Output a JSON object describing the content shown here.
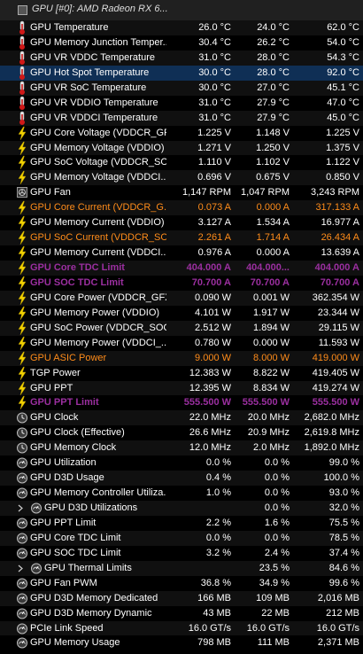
{
  "header": {
    "title": "GPU [#0]: AMD Radeon RX 6..."
  },
  "rows": [
    {
      "icon": "thermometer",
      "label": "GPU Temperature",
      "v": [
        "26.0 °C",
        "24.0 °C",
        "62.0 °C"
      ]
    },
    {
      "icon": "thermometer",
      "label": "GPU Memory Junction Temper...",
      "v": [
        "30.4 °C",
        "26.2 °C",
        "54.0 °C"
      ]
    },
    {
      "icon": "thermometer",
      "label": "GPU VR VDDC Temperature",
      "v": [
        "31.0 °C",
        "28.0 °C",
        "54.3 °C"
      ]
    },
    {
      "icon": "thermometer",
      "label": "GPU Hot Spot Temperature",
      "v": [
        "30.0 °C",
        "28.0 °C",
        "92.0 °C"
      ],
      "selected": true
    },
    {
      "icon": "thermometer",
      "label": "GPU VR SoC Temperature",
      "v": [
        "30.0 °C",
        "27.0 °C",
        "45.1 °C"
      ]
    },
    {
      "icon": "thermometer",
      "label": "GPU VR VDDIO Temperature",
      "v": [
        "31.0 °C",
        "27.9 °C",
        "47.0 °C"
      ]
    },
    {
      "icon": "thermometer",
      "label": "GPU VR VDDCI Temperature",
      "v": [
        "31.0 °C",
        "27.9 °C",
        "45.0 °C"
      ]
    },
    {
      "icon": "bolt",
      "label": "GPU Core Voltage (VDDCR_GFX)",
      "v": [
        "1.225 V",
        "1.148 V",
        "1.225 V"
      ]
    },
    {
      "icon": "bolt",
      "label": "GPU Memory Voltage (VDDIO)",
      "v": [
        "1.271 V",
        "1.250 V",
        "1.375 V"
      ]
    },
    {
      "icon": "bolt",
      "label": "GPU SoC Voltage (VDDCR_SOC)",
      "v": [
        "1.110 V",
        "1.102 V",
        "1.122 V"
      ]
    },
    {
      "icon": "bolt",
      "label": "GPU Memory Voltage (VDDCI...",
      "v": [
        "0.696 V",
        "0.675 V",
        "0.850 V"
      ]
    },
    {
      "icon": "fan",
      "label": "GPU Fan",
      "v": [
        "1,147 RPM",
        "1,047 RPM",
        "3,243 RPM"
      ]
    },
    {
      "icon": "bolt",
      "label": "GPU Core Current (VDDCR_G...",
      "v": [
        "0.073 A",
        "0.000 A",
        "317.133 A"
      ],
      "style": "warn"
    },
    {
      "icon": "bolt",
      "label": "GPU Memory Current (VDDIO)",
      "v": [
        "3.127 A",
        "1.534 A",
        "16.977 A"
      ]
    },
    {
      "icon": "bolt",
      "label": "GPU SoC Current (VDDCR_SOC)",
      "v": [
        "2.261 A",
        "1.714 A",
        "26.434 A"
      ],
      "style": "warn"
    },
    {
      "icon": "bolt",
      "label": "GPU Memory Current (VDDCI...",
      "v": [
        "0.976 A",
        "0.000 A",
        "13.639 A"
      ]
    },
    {
      "icon": "bolt",
      "label": "GPU Core TDC Limit",
      "v": [
        "404.000 A",
        "404.000...",
        "404.000 A"
      ],
      "style": "crit"
    },
    {
      "icon": "bolt",
      "label": "GPU SOC TDC Limit",
      "v": [
        "70.700 A",
        "70.700 A",
        "70.700 A"
      ],
      "style": "crit"
    },
    {
      "icon": "bolt",
      "label": "GPU Core Power (VDDCR_GFX)",
      "v": [
        "0.090 W",
        "0.001 W",
        "362.354 W"
      ]
    },
    {
      "icon": "bolt",
      "label": "GPU Memory Power (VDDIO)",
      "v": [
        "4.101 W",
        "1.917 W",
        "23.344 W"
      ]
    },
    {
      "icon": "bolt",
      "label": "GPU SoC Power (VDDCR_SOC)",
      "v": [
        "2.512 W",
        "1.894 W",
        "29.115 W"
      ]
    },
    {
      "icon": "bolt",
      "label": "GPU Memory Power (VDDCI_...",
      "v": [
        "0.780 W",
        "0.000 W",
        "11.593 W"
      ]
    },
    {
      "icon": "bolt",
      "label": "GPU ASIC Power",
      "v": [
        "9.000 W",
        "8.000 W",
        "419.000 W"
      ],
      "style": "warn"
    },
    {
      "icon": "bolt",
      "label": "TGP Power",
      "v": [
        "12.383 W",
        "8.822 W",
        "419.405 W"
      ]
    },
    {
      "icon": "bolt",
      "label": "GPU PPT",
      "v": [
        "12.395 W",
        "8.834 W",
        "419.274 W"
      ]
    },
    {
      "icon": "bolt",
      "label": "GPU PPT Limit",
      "v": [
        "555.500 W",
        "555.500 W",
        "555.500 W"
      ],
      "style": "crit"
    },
    {
      "icon": "clock",
      "label": "GPU Clock",
      "v": [
        "22.0 MHz",
        "20.0 MHz",
        "2,682.0 MHz"
      ]
    },
    {
      "icon": "clock",
      "label": "GPU Clock (Effective)",
      "v": [
        "26.6 MHz",
        "20.9 MHz",
        "2,619.8 MHz"
      ]
    },
    {
      "icon": "clock",
      "label": "GPU Memory Clock",
      "v": [
        "12.0 MHz",
        "2.0 MHz",
        "1,892.0 MHz"
      ]
    },
    {
      "icon": "gauge",
      "label": "GPU Utilization",
      "v": [
        "0.0 %",
        "0.0 %",
        "99.0 %"
      ]
    },
    {
      "icon": "gauge",
      "label": "GPU D3D Usage",
      "v": [
        "0.4 %",
        "0.0 %",
        "100.0 %"
      ]
    },
    {
      "icon": "gauge",
      "label": "GPU Memory Controller Utiliza...",
      "v": [
        "1.0 %",
        "0.0 %",
        "93.0 %"
      ]
    },
    {
      "icon": "gauge",
      "label": "GPU D3D Utilizations",
      "v": [
        "",
        "0.0 %",
        "32.0 %"
      ],
      "expander": true
    },
    {
      "icon": "gauge",
      "label": "GPU PPT Limit",
      "v": [
        "2.2 %",
        "1.6 %",
        "75.5 %"
      ]
    },
    {
      "icon": "gauge",
      "label": "GPU Core TDC Limit",
      "v": [
        "0.0 %",
        "0.0 %",
        "78.5 %"
      ]
    },
    {
      "icon": "gauge",
      "label": "GPU SOC TDC Limit",
      "v": [
        "3.2 %",
        "2.4 %",
        "37.4 %"
      ]
    },
    {
      "icon": "gauge",
      "label": "GPU Thermal Limits",
      "v": [
        "",
        "23.5 %",
        "84.6 %"
      ],
      "expander": true
    },
    {
      "icon": "gauge",
      "label": "GPU Fan PWM",
      "v": [
        "36.8 %",
        "34.9 %",
        "99.6 %"
      ]
    },
    {
      "icon": "gauge",
      "label": "GPU D3D Memory Dedicated",
      "v": [
        "166 MB",
        "109 MB",
        "2,016 MB"
      ]
    },
    {
      "icon": "gauge",
      "label": "GPU D3D Memory Dynamic",
      "v": [
        "43 MB",
        "22 MB",
        "212 MB"
      ]
    },
    {
      "icon": "gauge",
      "label": "PCIe Link Speed",
      "v": [
        "16.0 GT/s",
        "16.0 GT/s",
        "16.0 GT/s"
      ]
    },
    {
      "icon": "gauge",
      "label": "GPU Memory Usage",
      "v": [
        "798 MB",
        "111 MB",
        "2,371 MB"
      ]
    }
  ]
}
